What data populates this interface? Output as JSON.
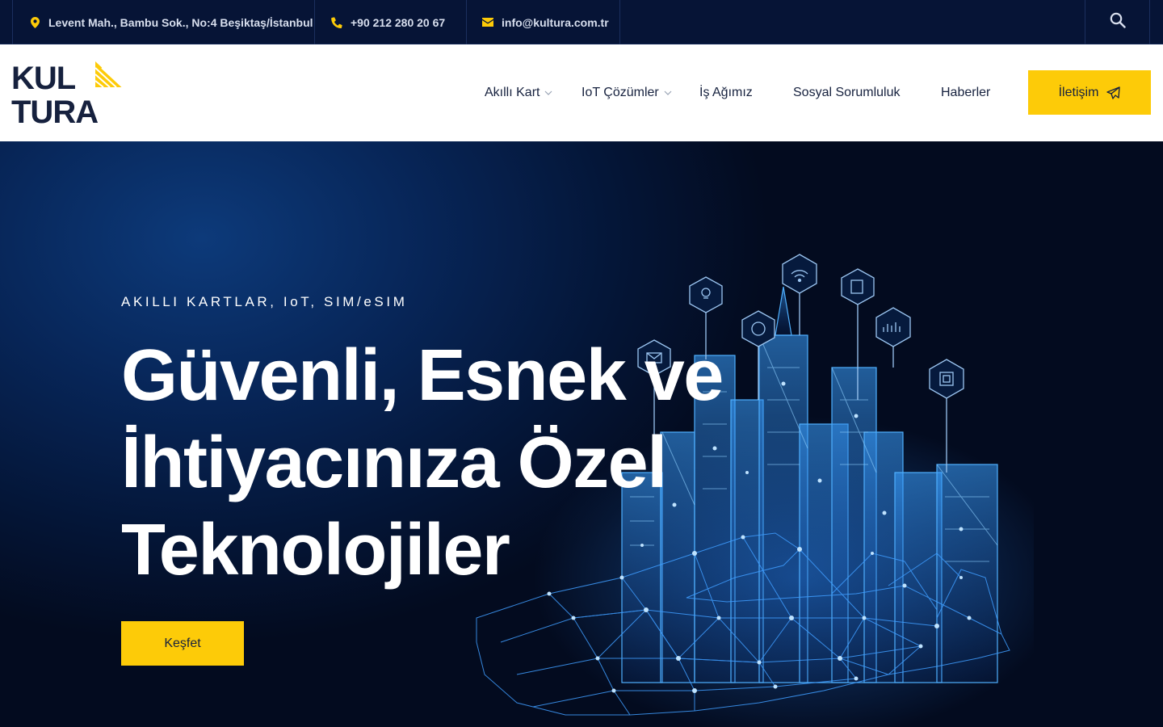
{
  "topbar": {
    "address": "Levent Mah., Bambu Sok., No:4 Beşiktaş/İstanbul",
    "phone": "+90 212 280 20 67",
    "email": "info@kultura.com.tr",
    "icons": {
      "address": "map-pin-icon",
      "phone": "phone-icon",
      "email": "envelope-icon",
      "search": "search-icon"
    }
  },
  "logo": {
    "line1": "KUL",
    "line2": "TURA"
  },
  "nav": {
    "items": [
      {
        "label": "Akıllı Kart",
        "has_dropdown": true
      },
      {
        "label": "IoT Çözümler",
        "has_dropdown": true
      },
      {
        "label": "İş Ağımız",
        "has_dropdown": false
      },
      {
        "label": "Sosyal Sorumluluk",
        "has_dropdown": false
      },
      {
        "label": "Haberler",
        "has_dropdown": false
      }
    ],
    "contact_label": "İletişim",
    "contact_icon": "paper-plane-icon"
  },
  "hero": {
    "eyebrow": "AKILLI KARTLAR, IoT, SIM/eSIM",
    "title_lines": [
      "Güvenli, Esnek ve",
      "İhtiyacınıza Özel",
      "Teknolojiler"
    ],
    "cta_label": "Keşfet"
  },
  "colors": {
    "accent": "#fdcb08",
    "topbar_bg": "#061436",
    "nav_text": "#16213e",
    "hero_bg": "#041536",
    "glow": "#2b8cff"
  }
}
